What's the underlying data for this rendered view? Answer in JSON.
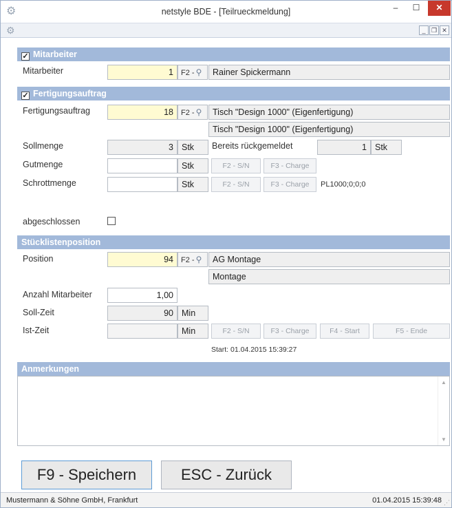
{
  "window": {
    "title": "netstyle BDE - [Teilrueckmeldung]",
    "icon": "gear-icon"
  },
  "mitarbeiter_section": {
    "header": "Mitarbeiter",
    "label": "Mitarbeiter",
    "value": "1",
    "f2": "F2 -",
    "name": "Rainer Spickermann"
  },
  "fertigung_section": {
    "header": "Fertigungsauftrag",
    "label": "Fertigungsauftrag",
    "value": "18",
    "f2": "F2 -",
    "desc1": "Tisch \"Design 1000\" (Eigenfertigung)",
    "desc2": "Tisch \"Design 1000\" (Eigenfertigung)",
    "sollmenge_label": "Sollmenge",
    "sollmenge_value": "3",
    "sollmenge_unit": "Stk",
    "bereits_label": "Bereits rückgemeldet",
    "bereits_value": "1",
    "bereits_unit": "Stk",
    "gutmenge_label": "Gutmenge",
    "gutmenge_value": "",
    "gutmenge_unit": "Stk",
    "gut_sn": "F2 - S/N",
    "gut_charge": "F3 - Charge",
    "schrott_label": "Schrottmenge",
    "schrott_value": "",
    "schrott_unit": "Stk",
    "schrott_sn": "F2 - S/N",
    "schrott_charge": "F3 - Charge",
    "schrott_code": "PL1000;0;0;0",
    "abgeschlossen_label": "abgeschlossen"
  },
  "stueckliste_section": {
    "header": "Stücklistenposition",
    "position_label": "Position",
    "position_value": "94",
    "f2": "F2 -",
    "position_desc1": "AG Montage",
    "position_desc2": "Montage",
    "anzahl_label": "Anzahl Mitarbeiter",
    "anzahl_value": "1,00",
    "sollzeit_label": "Soll-Zeit",
    "sollzeit_value": "90",
    "sollzeit_unit": "Min",
    "istzeit_label": "Ist-Zeit",
    "istzeit_value": "",
    "istzeit_unit": "Min",
    "ist_sn": "F2 - S/N",
    "ist_charge": "F3 - Charge",
    "ist_start": "F4 - Start",
    "ist_ende": "F5 - Ende",
    "start_text": "Start: 01.04.2015 15:39:27"
  },
  "anmerkungen": {
    "header": "Anmerkungen",
    "text": ""
  },
  "actions": {
    "save": "F9 - Speichern",
    "back": "ESC - Zurück"
  },
  "statusbar": {
    "company": "Mustermann & Söhne GmbH, Frankfurt",
    "datetime": "01.04.2015 15:39:48"
  }
}
